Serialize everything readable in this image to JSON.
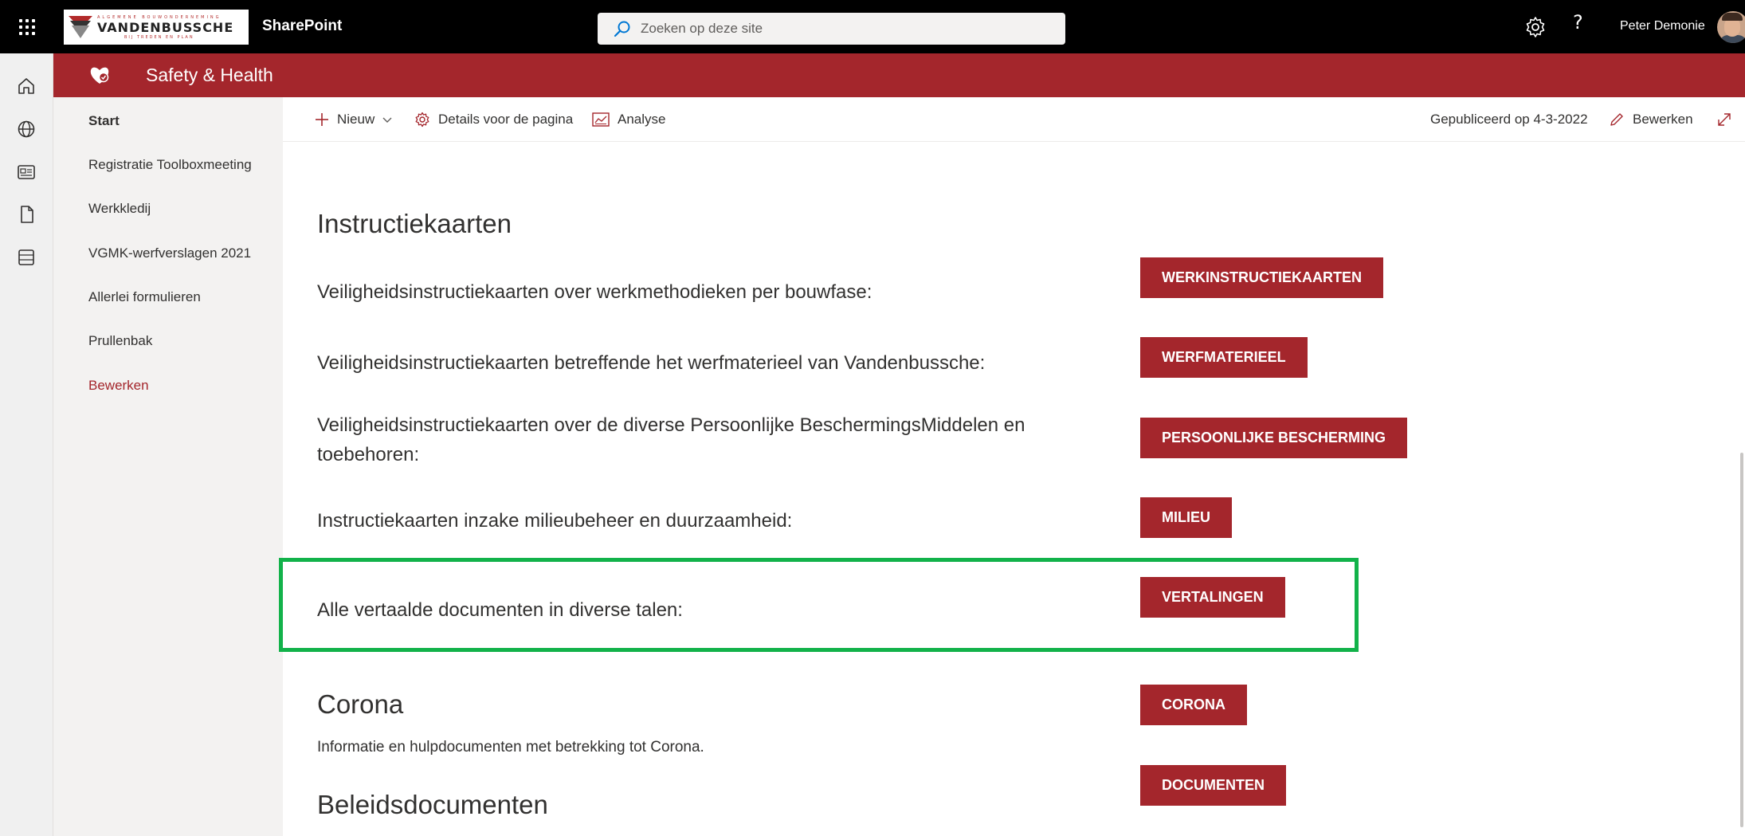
{
  "suite": {
    "app_name": "SharePoint",
    "org_logo": {
      "top_line": "ALGEMENE BOUWONDERNEMING",
      "name": "VANDENBUSSCHE",
      "tagline": "BIJ TREDEN EN PLAN"
    },
    "search_placeholder": "Zoeken op deze site",
    "help_label": "?",
    "user_name": "Peter Demonie"
  },
  "appbar": {
    "icons": [
      "home-icon",
      "globe-icon",
      "news-icon",
      "file-icon",
      "list-icon"
    ]
  },
  "site": {
    "title": "Safety & Health"
  },
  "nav": {
    "items": [
      {
        "label": "Start"
      },
      {
        "label": "Registratie Toolboxmeeting"
      },
      {
        "label": "Werkkledij"
      },
      {
        "label": "VGMK-werfverslagen 2021"
      },
      {
        "label": "Allerlei formulieren"
      },
      {
        "label": "Prullenbak"
      }
    ],
    "edit_label": "Bewerken"
  },
  "command_bar": {
    "new_label": "Nieuw",
    "details_label": "Details voor de pagina",
    "analytics_label": "Analyse",
    "published_label": "Gepubliceerd op 4-3-2022",
    "edit_label": "Bewerken"
  },
  "content": {
    "section1_title": "Instructiekaarten",
    "rows": [
      {
        "text": "Veiligheidsinstructiekaarten over werkmethodieken per bouwfase:",
        "button": "WERKINSTRUCTIEKAARTEN"
      },
      {
        "text": "Veiligheidsinstructiekaarten betreffende het werfmaterieel van Vandenbussche:",
        "button": "WERFMATERIEEL"
      },
      {
        "text_line1": "Veiligheidsinstructiekaarten over de diverse Persoonlijke BeschermingsMiddelen en",
        "text_line2": "toebehoren:",
        "button": "PERSOONLIJKE BESCHERMING"
      },
      {
        "text": "Instructiekaarten inzake milieubeheer en duurzaamheid:",
        "button": "MILIEU"
      },
      {
        "text": "Alle vertaalde documenten in diverse talen:",
        "button": "VERTALINGEN"
      }
    ],
    "section2_title": "Corona",
    "section2_desc": "Informatie en hulpdocumenten met betrekking tot Corona.",
    "corona_button": "CORONA",
    "documents_button": "DOCUMENTEN",
    "section3_title": "Beleidsdocumenten"
  },
  "colors": {
    "suite_bar": "#000000",
    "site_header": "#a4262c",
    "button": "#a4262c",
    "highlight": "#12b24a",
    "nav_bg": "#f3f2f1"
  }
}
